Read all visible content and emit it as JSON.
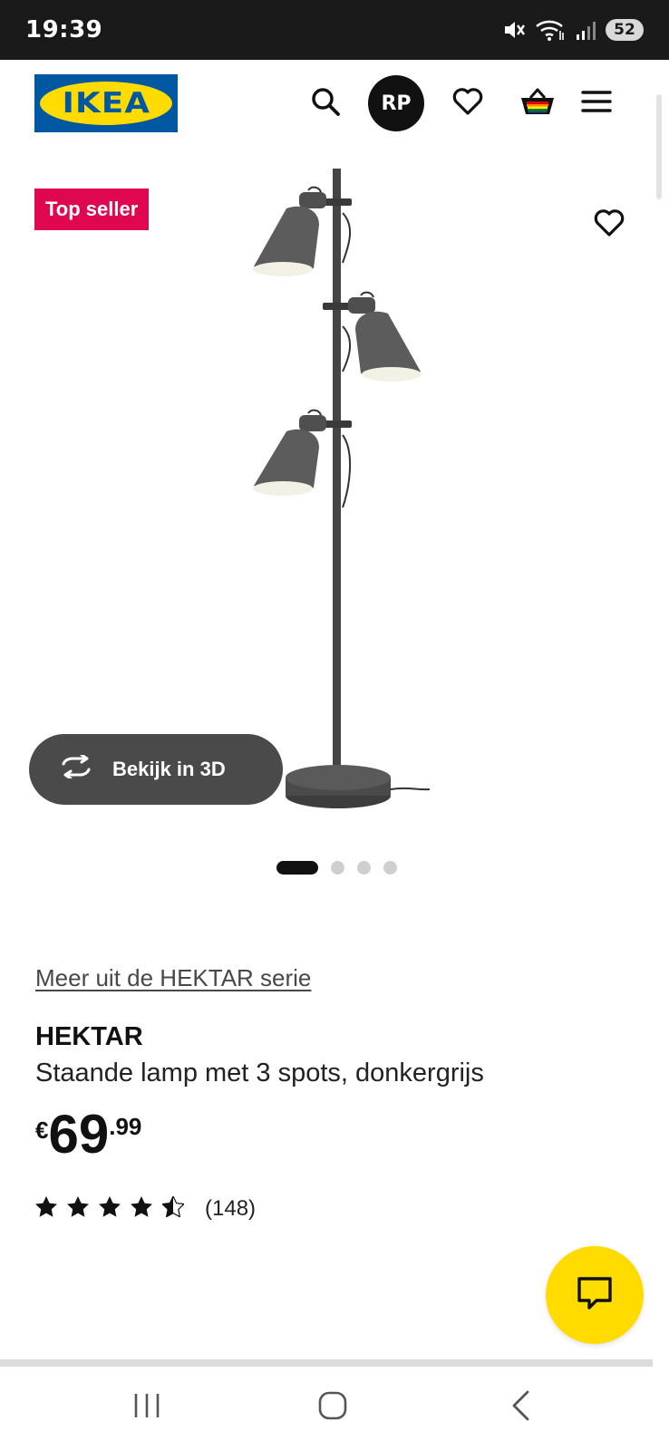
{
  "status_bar": {
    "time": "19:39",
    "battery": "52",
    "icons": [
      "mute-icon",
      "wifi-icon",
      "signal-icon",
      "battery-icon"
    ]
  },
  "header": {
    "logo_text": "IKEA",
    "avatar_initials": "RP",
    "icons": [
      "search-icon",
      "heart-icon",
      "basket-icon",
      "menu-icon"
    ]
  },
  "product_image": {
    "badge": "Top seller",
    "view_3d_label": "Bekijk in 3D",
    "pager": {
      "total": 4,
      "active": 1
    }
  },
  "product": {
    "series_link": "Meer uit de HEKTAR serie",
    "name": "HEKTAR",
    "description": "Staande lamp met 3 spots, donkergrijs",
    "price_currency": "€",
    "price_integer": "69",
    "price_decimal": ".99",
    "rating": 4.5,
    "rating_count": "(148)"
  },
  "colors": {
    "ikea_blue": "#0058a3",
    "ikea_yellow": "#ffdb00",
    "badge_red": "#e00751"
  }
}
